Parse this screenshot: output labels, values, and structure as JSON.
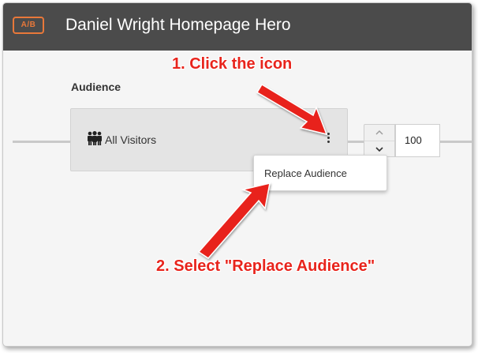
{
  "header": {
    "badge": "A/B",
    "title": "Daniel Wright Homepage Hero"
  },
  "audience": {
    "section_label": "Audience",
    "name": "All Visitors",
    "icon": "people-icon",
    "menu_icon": "more-vertical-icon"
  },
  "allocation": {
    "value": "100",
    "up_icon": "chevron-up-icon",
    "down_icon": "chevron-down-icon"
  },
  "menu": {
    "items": [
      "Replace Audience"
    ]
  },
  "annotations": {
    "step1": "1. Click the icon",
    "step2": "2. Select \"Replace Audience\"",
    "color": "#e8241c"
  },
  "colors": {
    "header_bg": "#4b4b4b",
    "badge": "#e8783a",
    "card_bg": "#e4e4e4"
  }
}
